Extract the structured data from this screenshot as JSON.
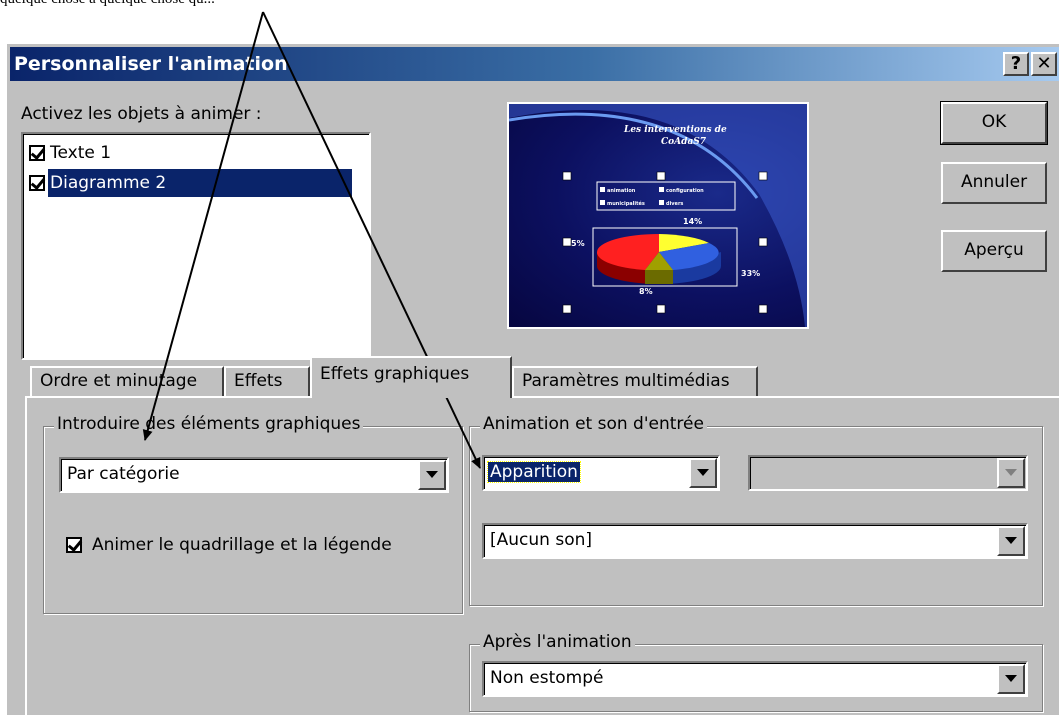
{
  "caption": "quelque chose à quelque chose qu...",
  "window": {
    "title": "Personnaliser l'animation",
    "help_label": "?",
    "close_label": "✕"
  },
  "objects": {
    "label": "Activez les objets à animer :",
    "items": [
      {
        "label": "Texte 1",
        "checked": true,
        "selected": false
      },
      {
        "label": "Diagramme 2",
        "checked": true,
        "selected": true
      }
    ]
  },
  "buttons": {
    "ok": "OK",
    "cancel": "Annuler",
    "preview": "Aperçu"
  },
  "preview": {
    "slide_title_line1": "Les interventions de",
    "slide_title_line2": "CoAdaS7",
    "legend": [
      "animation",
      "configuration",
      "municipalités",
      "divers"
    ],
    "pct_top": "14%",
    "pct_left": "5%",
    "pct_right": "33%",
    "pct_bottom": "8%"
  },
  "tabs": [
    "Ordre et minutage",
    "Effets",
    "Effets graphiques",
    "Paramètres multimédias"
  ],
  "active_tab": "Effets graphiques",
  "intro": {
    "group_label": "Introduire des éléments graphiques",
    "combo_value": "Par catégorie",
    "checkbox_label": "Animer le quadrillage et la légende",
    "checkbox_checked": true
  },
  "entry": {
    "group_label": "Animation et son d'entrée",
    "effect_value": "Apparition",
    "direction_value": "",
    "sound_value": "[Aucun son]"
  },
  "after": {
    "group_label": "Après l'animation",
    "value": "Non estompé"
  },
  "colors": {
    "title_bar": "#0a246a",
    "selection": "#0a246a",
    "face": "#c0c0c0"
  }
}
